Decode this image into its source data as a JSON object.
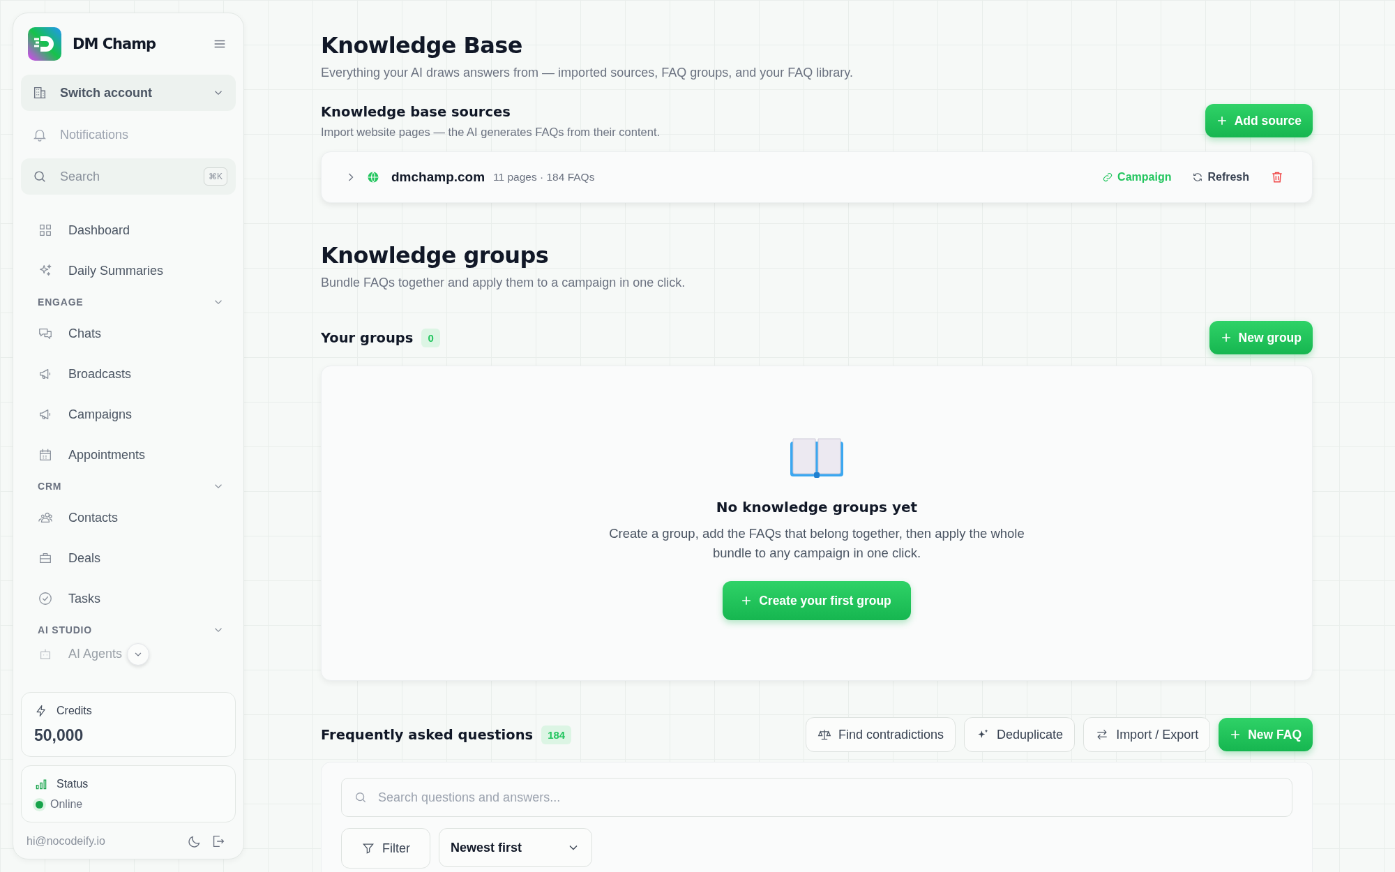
{
  "sidebar": {
    "brand": "DM Champ",
    "account": {
      "label": "Switch account"
    },
    "notifications": "Notifications",
    "search": {
      "placeholder": "Search",
      "shortcut": "⌘K"
    },
    "nav": [
      {
        "kind": "link",
        "label": "Dashboard"
      },
      {
        "kind": "link",
        "label": "Daily Summaries"
      },
      {
        "kind": "section",
        "label": "ENGAGE",
        "expanded": true
      },
      {
        "kind": "link",
        "label": "Chats"
      },
      {
        "kind": "link",
        "label": "Broadcasts"
      },
      {
        "kind": "link",
        "label": "Campaigns"
      },
      {
        "kind": "link",
        "label": "Appointments"
      },
      {
        "kind": "section",
        "label": "CRM",
        "expanded": true
      },
      {
        "kind": "link",
        "label": "Contacts"
      },
      {
        "kind": "link",
        "label": "Deals"
      },
      {
        "kind": "link",
        "label": "Tasks"
      },
      {
        "kind": "section",
        "label": "AI STUDIO",
        "expanded": true
      },
      {
        "kind": "link",
        "label": "AI Agents"
      }
    ],
    "credits": {
      "label": "Credits",
      "value": "50,000"
    },
    "status": {
      "label": "Status",
      "value": "Online",
      "color": "#16a34a"
    },
    "email": "hi@nocodeify.io"
  },
  "page": {
    "title": "Knowledge Base",
    "subtitle": "Everything your AI draws answers from — imported sources, FAQ groups, and your FAQ library."
  },
  "sources": {
    "title": "Knowledge base sources",
    "subtitle": "Import website pages — the AI generates FAQs from their content.",
    "add_button": "Add source",
    "rows": [
      {
        "name": "dmchamp.com",
        "meta": "11 pages · 184 FAQs",
        "expanded": false,
        "campaign": "Campaign",
        "refresh": "Refresh"
      }
    ]
  },
  "groups": {
    "title": "Knowledge groups",
    "subtitle": "Bundle FAQs together and apply them to a campaign in one click.",
    "list_title": "Your groups",
    "count": "0",
    "new_button": "New group",
    "empty": {
      "title": "No knowledge groups yet",
      "text": "Create a group, add the FAQs that belong together, then apply the whole bundle to any campaign in one click.",
      "button": "Create your first group"
    }
  },
  "faq": {
    "title": "Frequently asked questions",
    "count": "184",
    "actions": [
      "Find contradictions",
      "Deduplicate",
      "Import / Export"
    ],
    "new_button": "New FAQ",
    "search": {
      "placeholder": "Search questions and answers..."
    },
    "filter": "Filter",
    "sort": "Newest first"
  }
}
